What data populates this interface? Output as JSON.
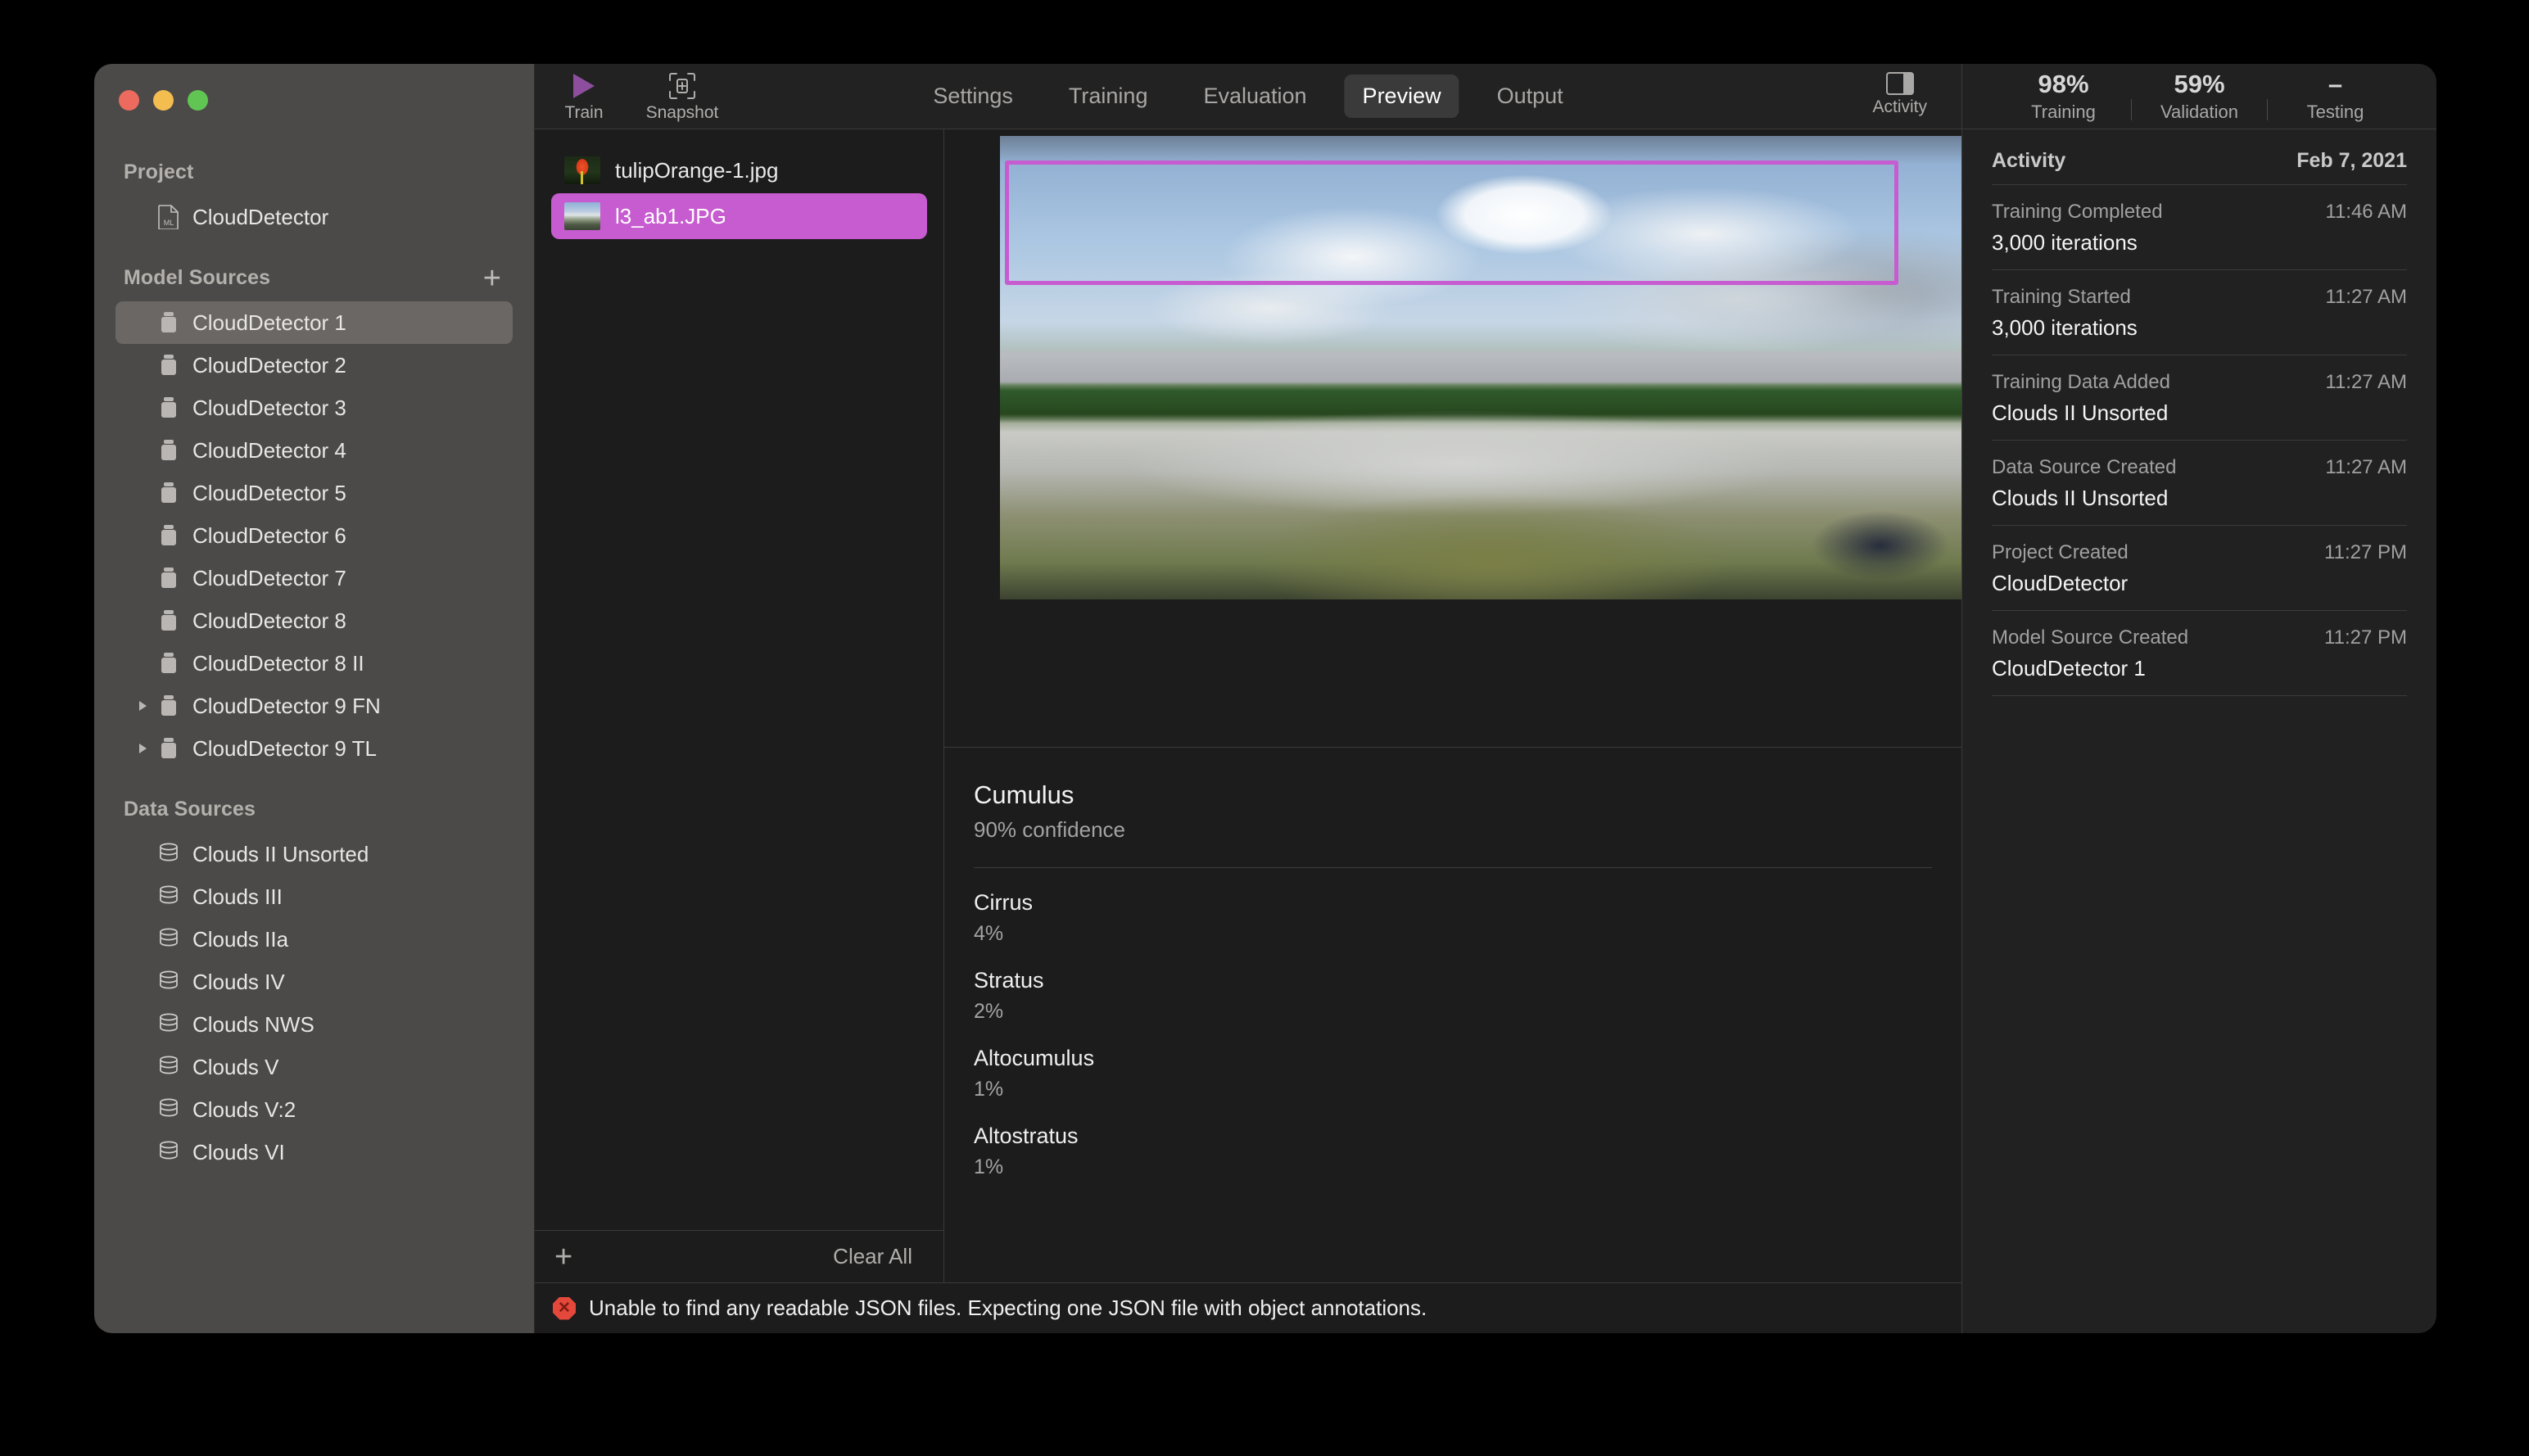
{
  "window": {
    "traffic_lights": [
      "close",
      "minimize",
      "maximize"
    ]
  },
  "sidebar": {
    "project_section_label": "Project",
    "project_item": {
      "label": "CloudDetector",
      "icon": "ml-document-icon"
    },
    "model_sources_label": "Model Sources",
    "add_model_source_label": "+",
    "model_sources": [
      {
        "label": "CloudDetector 1",
        "selected": true,
        "expandable": false
      },
      {
        "label": "CloudDetector 2",
        "selected": false,
        "expandable": false
      },
      {
        "label": "CloudDetector 3",
        "selected": false,
        "expandable": false
      },
      {
        "label": "CloudDetector 4",
        "selected": false,
        "expandable": false
      },
      {
        "label": "CloudDetector 5",
        "selected": false,
        "expandable": false
      },
      {
        "label": "CloudDetector 6",
        "selected": false,
        "expandable": false
      },
      {
        "label": "CloudDetector 7",
        "selected": false,
        "expandable": false
      },
      {
        "label": "CloudDetector 8",
        "selected": false,
        "expandable": false
      },
      {
        "label": "CloudDetector 8 II",
        "selected": false,
        "expandable": false
      },
      {
        "label": "CloudDetector 9 FN",
        "selected": false,
        "expandable": true
      },
      {
        "label": "CloudDetector 9 TL",
        "selected": false,
        "expandable": true
      }
    ],
    "data_sources_label": "Data Sources",
    "data_sources": [
      {
        "label": "Clouds II Unsorted"
      },
      {
        "label": "Clouds III"
      },
      {
        "label": "Clouds IIa"
      },
      {
        "label": "Clouds IV"
      },
      {
        "label": "Clouds NWS"
      },
      {
        "label": "Clouds V"
      },
      {
        "label": "Clouds V:2"
      },
      {
        "label": "Clouds VI"
      }
    ]
  },
  "toolbar": {
    "train_label": "Train",
    "snapshot_label": "Snapshot",
    "tabs": [
      {
        "label": "Settings",
        "active": false
      },
      {
        "label": "Training",
        "active": false
      },
      {
        "label": "Evaluation",
        "active": false
      },
      {
        "label": "Preview",
        "active": true
      },
      {
        "label": "Output",
        "active": false
      }
    ],
    "activity_label": "Activity"
  },
  "filelist": {
    "items": [
      {
        "name": "tulipOrange-1.jpg",
        "selected": false,
        "thumb": "tulip"
      },
      {
        "name": "l3_ab1.JPG",
        "selected": true,
        "thumb": "pano"
      }
    ],
    "add_label": "+",
    "clear_all_label": "Clear All",
    "selection_color": "#c75bd0"
  },
  "preview": {
    "bounding_box_color": "#c75bd0",
    "top_prediction": {
      "class": "Cumulus",
      "confidence": "90% confidence"
    },
    "other_predictions": [
      {
        "class": "Cirrus",
        "pct": "4%"
      },
      {
        "class": "Stratus",
        "pct": "2%"
      },
      {
        "class": "Altocumulus",
        "pct": "1%"
      },
      {
        "class": "Altostratus",
        "pct": "1%"
      }
    ]
  },
  "error_bar": {
    "icon": "error-octagon-icon",
    "message": "Unable to find any readable JSON files. Expecting one JSON file with object annotations.",
    "color": "#e4483a"
  },
  "activity_panel": {
    "metrics": [
      {
        "value": "98%",
        "label": "Training"
      },
      {
        "value": "59%",
        "label": "Validation"
      },
      {
        "value": "–",
        "label": "Testing"
      }
    ],
    "header_title": "Activity",
    "header_date": "Feb 7, 2021",
    "items": [
      {
        "label": "Training Completed",
        "time": "11:46 AM",
        "value": "3,000 iterations"
      },
      {
        "label": "Training Started",
        "time": "11:27 AM",
        "value": "3,000 iterations"
      },
      {
        "label": "Training Data Added",
        "time": "11:27 AM",
        "value": "Clouds II Unsorted"
      },
      {
        "label": "Data Source Created",
        "time": "11:27 AM",
        "value": "Clouds II Unsorted"
      },
      {
        "label": "Project Created",
        "time": "11:27 PM",
        "value": "CloudDetector"
      },
      {
        "label": "Model Source Created",
        "time": "11:27 PM",
        "value": "CloudDetector 1"
      }
    ]
  }
}
